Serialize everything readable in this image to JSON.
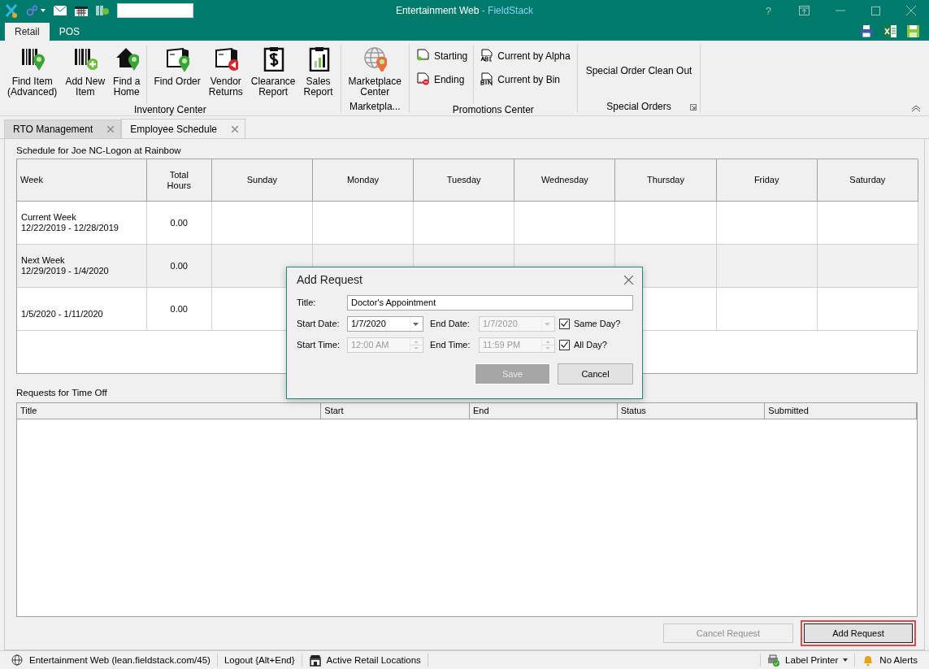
{
  "window": {
    "app": "Entertainment Web",
    "product": "- FieldStack",
    "help": "?"
  },
  "ribbon_tabs": [
    {
      "label": "Retail",
      "selected": true
    },
    {
      "label": "POS",
      "selected": false
    }
  ],
  "ribbon_groups": [
    {
      "label": "Inventory Center",
      "launcher": false,
      "items": [
        {
          "kind": "large",
          "lines": [
            "Find Item",
            "(Advanced)"
          ]
        },
        {
          "kind": "large",
          "lines": [
            "Add New",
            "Item"
          ]
        },
        {
          "kind": "large",
          "lines": [
            "Find a",
            "Home"
          ]
        },
        {
          "kind": "separator"
        },
        {
          "kind": "large",
          "lines": [
            "Find Order"
          ]
        },
        {
          "kind": "large",
          "lines": [
            "Vendor",
            "Returns"
          ]
        },
        {
          "kind": "large",
          "lines": [
            "Clearance",
            "Report"
          ]
        },
        {
          "kind": "large",
          "lines": [
            "Sales",
            "Report"
          ]
        }
      ]
    },
    {
      "label": "Marketpla...",
      "launcher": false,
      "items": [
        {
          "kind": "large",
          "lines": [
            "Marketplace",
            "Center"
          ]
        }
      ]
    },
    {
      "label": "Promotions Center",
      "launcher": false,
      "items": [
        {
          "kind": "stack",
          "items": [
            "Starting",
            "Ending"
          ]
        },
        {
          "kind": "separator"
        },
        {
          "kind": "stack",
          "items": [
            "Current by Alpha",
            "Current by Bin"
          ]
        }
      ]
    },
    {
      "label": "Special Orders",
      "launcher": true,
      "items": [
        {
          "kind": "text",
          "label": "Special Order Clean Out"
        }
      ]
    }
  ],
  "doc_tabs": [
    {
      "label": "RTO Management",
      "selected": false
    },
    {
      "label": "Employee Schedule",
      "selected": true
    }
  ],
  "schedule": {
    "caption": "Schedule for Joe NC-Logon at Rainbow",
    "columns": [
      [
        "Week"
      ],
      [
        "Total",
        "Hours"
      ],
      [
        "Sunday"
      ],
      [
        "Monday"
      ],
      [
        "Tuesday"
      ],
      [
        "Wednesday"
      ],
      [
        "Thursday"
      ],
      [
        "Friday"
      ],
      [
        "Saturday"
      ]
    ],
    "rows": [
      {
        "week": "Current Week",
        "dates": "12/22/2019 - 12/28/2019",
        "total_hours": "0.00"
      },
      {
        "week": "Next Week",
        "dates": "12/29/2019 - 1/4/2020",
        "total_hours": "0.00"
      },
      {
        "dates": "1/5/2020 - 1/11/2020",
        "total_hours": "0.00"
      }
    ]
  },
  "requests": {
    "caption": "Requests for Time Off",
    "columns": [
      "Title",
      "Start",
      "End",
      "Status",
      "Submitted"
    ]
  },
  "buttons": [
    {
      "label": "Cancel Request",
      "disabled": true,
      "highlighted": false
    },
    {
      "label": "Add Request",
      "disabled": false,
      "highlighted": true
    }
  ],
  "dialog": {
    "title": "Add Request",
    "title_field": {
      "label": "Title:",
      "value": "Doctor's Appointment"
    },
    "rows": [
      {
        "fields": [
          {
            "label": "Start Date:",
            "value": "1/7/2020",
            "kind": "dropdown",
            "disabled": false
          },
          {
            "label": "End Date:",
            "value": "1/7/2020",
            "kind": "dropdown",
            "disabled": true
          }
        ],
        "checkbox": {
          "label": "Same Day?",
          "checked": true
        }
      },
      {
        "fields": [
          {
            "label": "Start Time:",
            "value": "12:00 AM",
            "kind": "spinner",
            "disabled": true
          },
          {
            "label": "End Time:",
            "value": "11:59 PM",
            "kind": "spinner",
            "disabled": true
          }
        ],
        "checkbox": {
          "label": "All Day?",
          "checked": true
        }
      }
    ],
    "buttons": [
      {
        "label": "Save",
        "disabled": true
      },
      {
        "label": "Cancel",
        "disabled": false
      }
    ]
  },
  "status_bar": {
    "left": [
      {
        "label": "Entertainment Web (lean.fieldstack.com/45)"
      },
      {
        "label": "Logout {Alt+End}"
      },
      {
        "label": "Active Retail Locations"
      }
    ],
    "right": [
      {
        "label": "Label Printer",
        "dropdown": true
      },
      {
        "label": "No Alerts",
        "dropdown": false
      }
    ]
  }
}
